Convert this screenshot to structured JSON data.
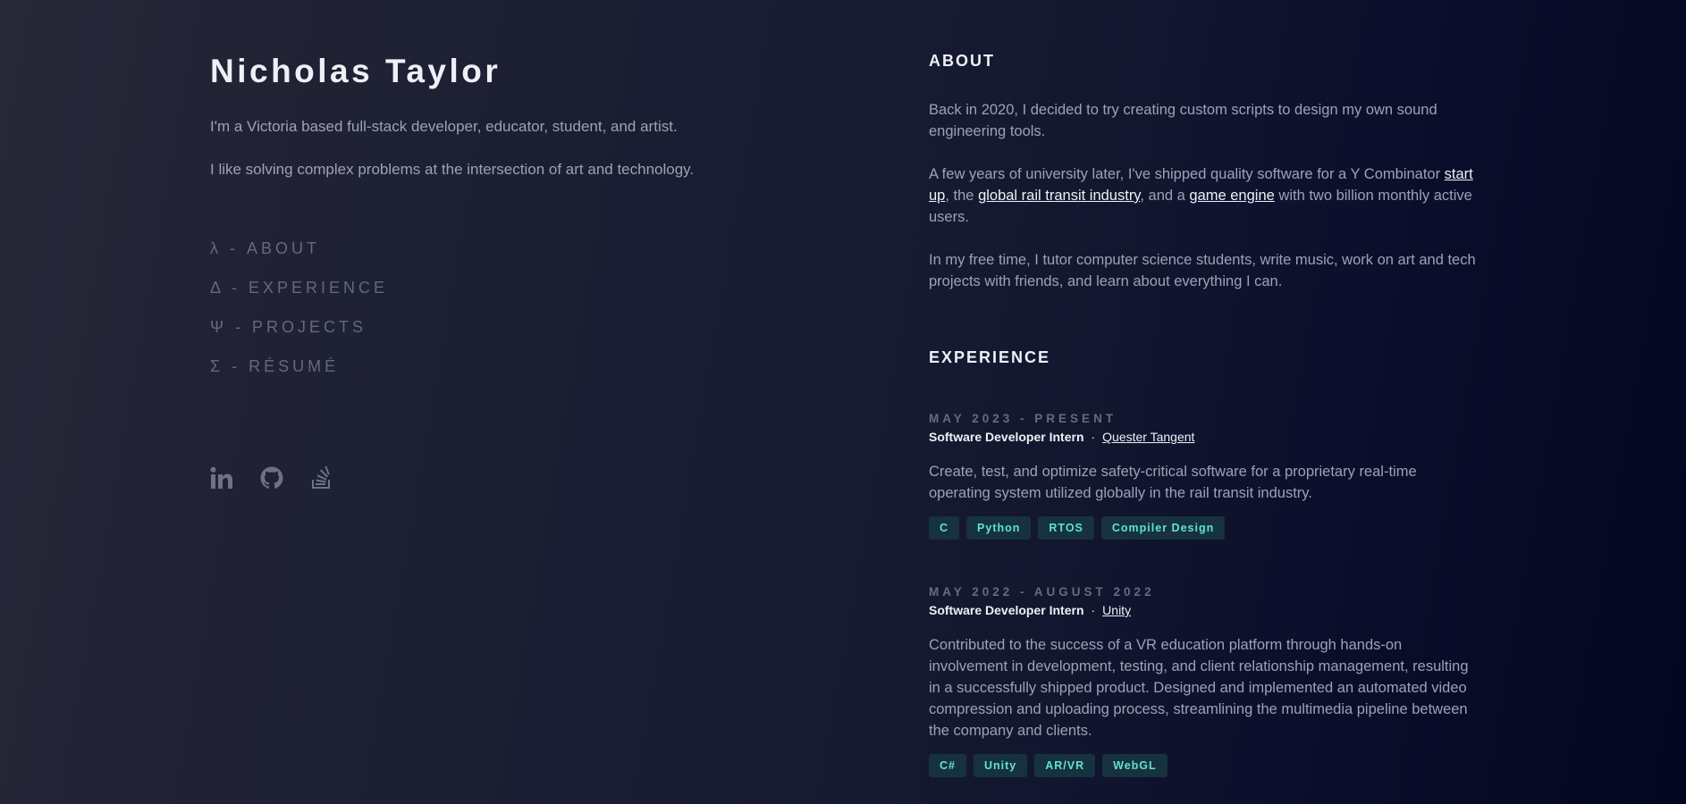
{
  "profile": {
    "name": "Nicholas Taylor",
    "intro1": "I'm a Victoria based full-stack developer, educator, student, and artist.",
    "intro2": "I like solving complex problems at the intersection of art and technology."
  },
  "nav": {
    "items": [
      {
        "label": "λ - ABOUT"
      },
      {
        "label": "Δ - EXPERIENCE"
      },
      {
        "label": "Ψ - PROJECTS"
      },
      {
        "label": "Σ - RÉSUMÉ"
      }
    ]
  },
  "socials": {
    "icons": [
      "linkedin-icon",
      "github-icon",
      "stackoverflow-icon"
    ],
    "icon_color": "#6b7385"
  },
  "about": {
    "title": "ABOUT",
    "p1": "Back in 2020, I decided to try creating custom scripts to design my own sound engineering tools.",
    "p2_part1": "A few years of university later, I've shipped quality software for a Y Combinator ",
    "p2_link1": "start up",
    "p2_part2": ", the ",
    "p2_link2": "global rail transit industry",
    "p2_part3": ", and a ",
    "p2_link3": "game engine",
    "p2_part4": " with two billion monthly active users.",
    "p3": "In my free time, I tutor computer science students, write music, work on art and tech projects with friends, and learn about everything I can."
  },
  "experience": {
    "title": "EXPERIENCE",
    "jobs": [
      {
        "date": "MAY 2023 - PRESENT",
        "role": "Software Developer Intern",
        "separator": "·",
        "company": "Quester Tangent",
        "description": "Create, test, and optimize safety-critical software for a proprietary real-time operating system utilized globally in the rail transit industry.",
        "tags": [
          "C",
          "Python",
          "RTOS",
          "Compiler Design"
        ]
      },
      {
        "date": "MAY 2022 - AUGUST 2022",
        "role": "Software Developer Intern",
        "separator": "·",
        "company": "Unity",
        "description": "Contributed to the success of a VR education platform through hands-on involvement in development, testing, and client relationship management, resulting in a successfully shipped product. Designed and implemented an automated video compression and uploading process, streamlining the multimedia pipeline between the company and clients.",
        "tags": [
          "C#",
          "Unity",
          "AR/VR",
          "WebGL"
        ]
      }
    ]
  },
  "colors": {
    "accent_tag_text": "#5fe3d0",
    "tag_background": "#16323f",
    "heading": "#eef0f6",
    "body_text": "#9aa3b5",
    "muted": "#626a7d"
  }
}
